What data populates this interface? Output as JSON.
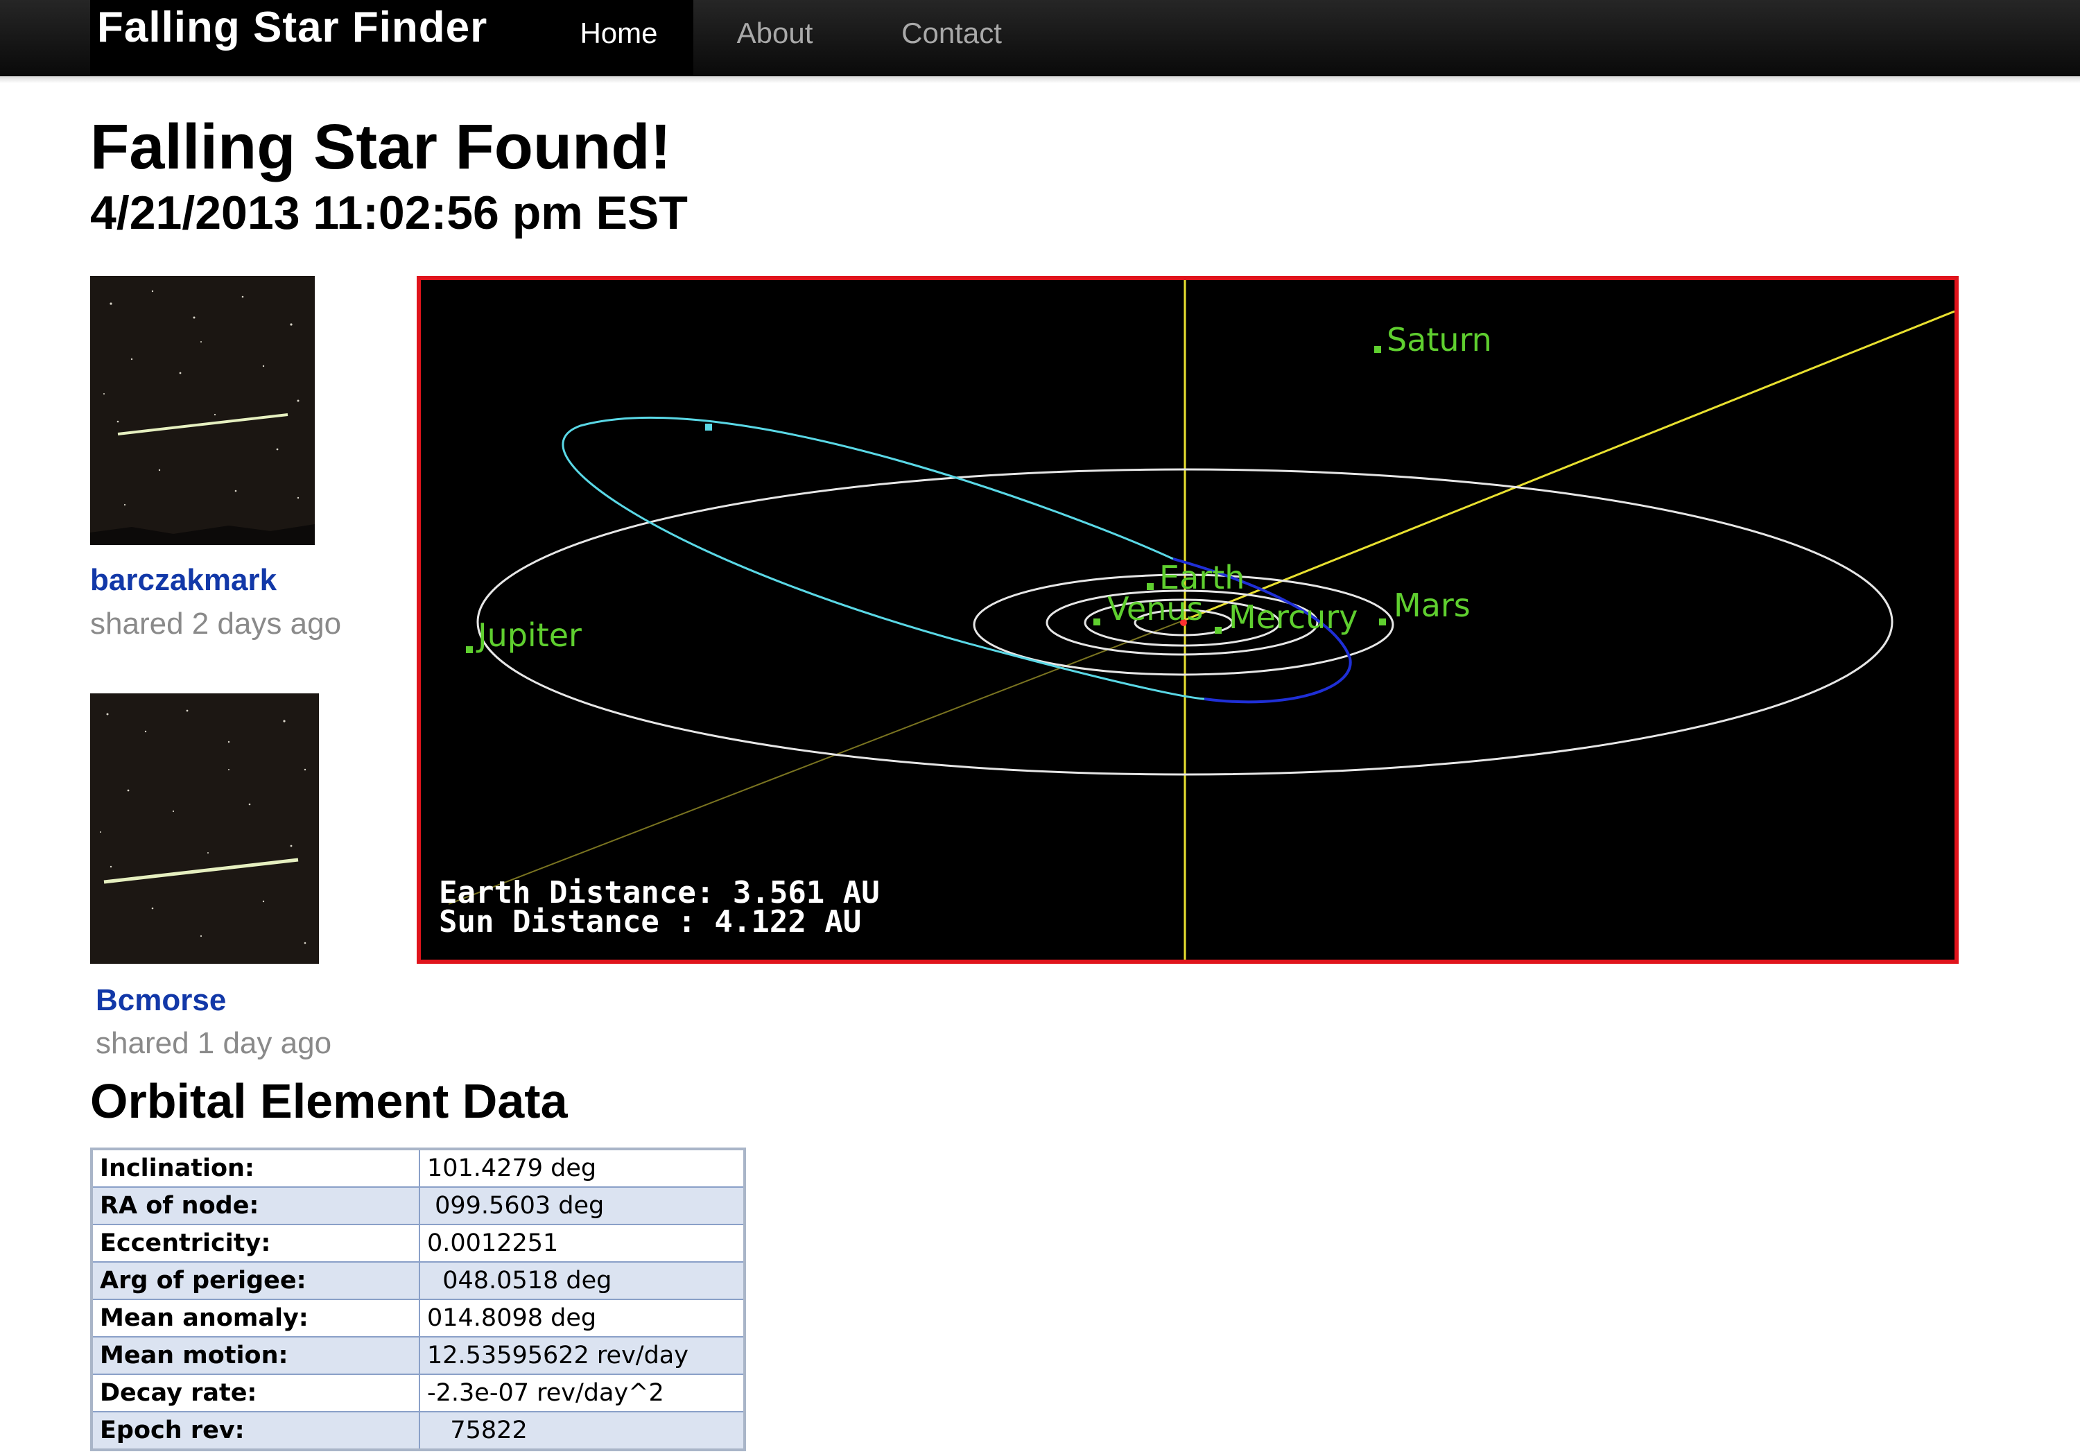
{
  "navbar": {
    "brand": "Falling Star Finder",
    "links": [
      {
        "label": "Home",
        "active": true
      },
      {
        "label": "About",
        "active": false
      },
      {
        "label": "Contact",
        "active": false
      }
    ],
    "background": "#111111"
  },
  "page": {
    "title": "Falling Star Found!",
    "subtitle": "4/21/2013 11:02:56 pm EST"
  },
  "shares": [
    {
      "user": "barczakmark",
      "shared": "shared 2 days ago"
    },
    {
      "user": "Bcmorse",
      "shared": "shared 1 day ago"
    }
  ],
  "orbit_view": {
    "planets": [
      "Saturn",
      "Earth",
      "Venus",
      "Mercury",
      "Mars",
      "Jupiter"
    ],
    "earth_distance": "Earth Distance: 3.561 AU",
    "sun_distance": "Sun Distance  : 4.122 AU",
    "border_color": "#e0141c",
    "orbit_colors": {
      "planet": "#e6e6e6",
      "object": "#5ad8e6",
      "object_below": "#1f2fd6",
      "axis": "#e8e030",
      "label": "#5fcf2f"
    }
  },
  "orbital_elements": {
    "title": "Orbital Element Data",
    "rows": [
      {
        "key": "Inclination:",
        "value": "101.4279 deg"
      },
      {
        "key": "RA of node:",
        "value": " 099.5603 deg"
      },
      {
        "key": "Eccentricity:",
        "value": "0.0012251"
      },
      {
        "key": "Arg of perigee:",
        "value": "  048.0518 deg"
      },
      {
        "key": "Mean anomaly:",
        "value": "014.8098 deg"
      },
      {
        "key": "Mean motion:",
        "value": "12.53595622 rev/day"
      },
      {
        "key": "Decay rate:",
        "value": "-2.3e-07 rev/day^2"
      },
      {
        "key": "Epoch rev:",
        "value": "   75822"
      }
    ]
  }
}
